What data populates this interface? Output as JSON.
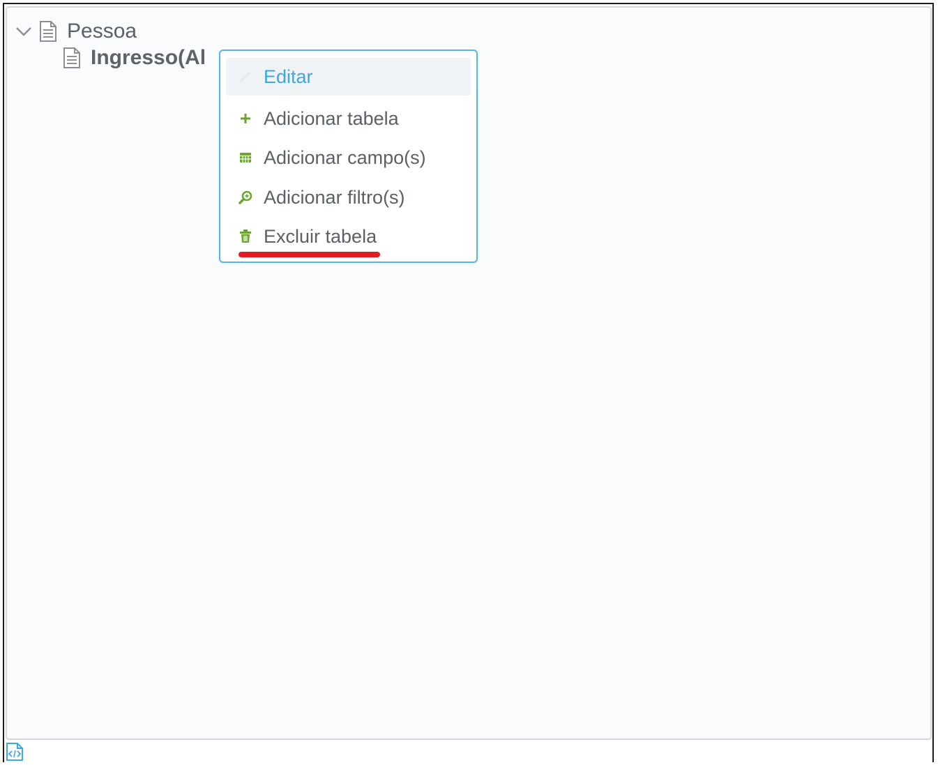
{
  "tree": {
    "root": {
      "label": "Pessoa",
      "expanded": true,
      "icon": "document-icon",
      "toggle_icon": "chevron-down-icon"
    },
    "child": {
      "label": "Ingresso(Al",
      "icon": "document-icon"
    }
  },
  "context_menu": {
    "items": [
      {
        "label": "Editar",
        "icon": "pencil-icon",
        "active": true
      },
      {
        "label": "Adicionar tabela",
        "icon": "plus-icon"
      },
      {
        "label": "Adicionar campo(s)",
        "icon": "table-grid-icon"
      },
      {
        "label": "Adicionar filtro(s)",
        "icon": "search-filter-icon"
      },
      {
        "label": "Excluir tabela",
        "icon": "trash-icon"
      }
    ]
  },
  "annotation": {
    "color": "#e31b23",
    "target": "Excluir tabela"
  },
  "footer": {
    "icon": "code-file-icon"
  },
  "colors": {
    "accent": "#3ea6e0",
    "menu_border": "#5ab4e5",
    "icon_green": "#6aa52e",
    "text": "#5a6066",
    "panel_bg": "#fafbfd"
  }
}
